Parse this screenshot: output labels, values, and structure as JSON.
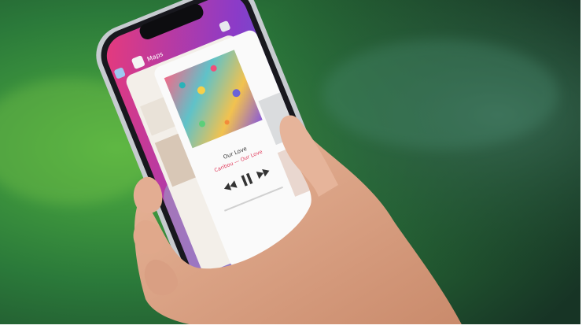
{
  "colors": {
    "background_green": "#2f8c3a",
    "background_dark": "#1a3b2a",
    "phone_frame": "#1c1c22",
    "steel_band": "#bfc3c8",
    "skin": "#d9a487",
    "accent_red": "#e0395a"
  },
  "app_switcher": {
    "back_card_label": "Maps",
    "now_playing": {
      "song": "Our Love",
      "artist": "Caribou — Our Love"
    },
    "controls": [
      "rewind-icon",
      "pause-icon",
      "fast-forward-icon"
    ]
  },
  "icons": [
    "maps-app-icon",
    "music-app-icon"
  ]
}
